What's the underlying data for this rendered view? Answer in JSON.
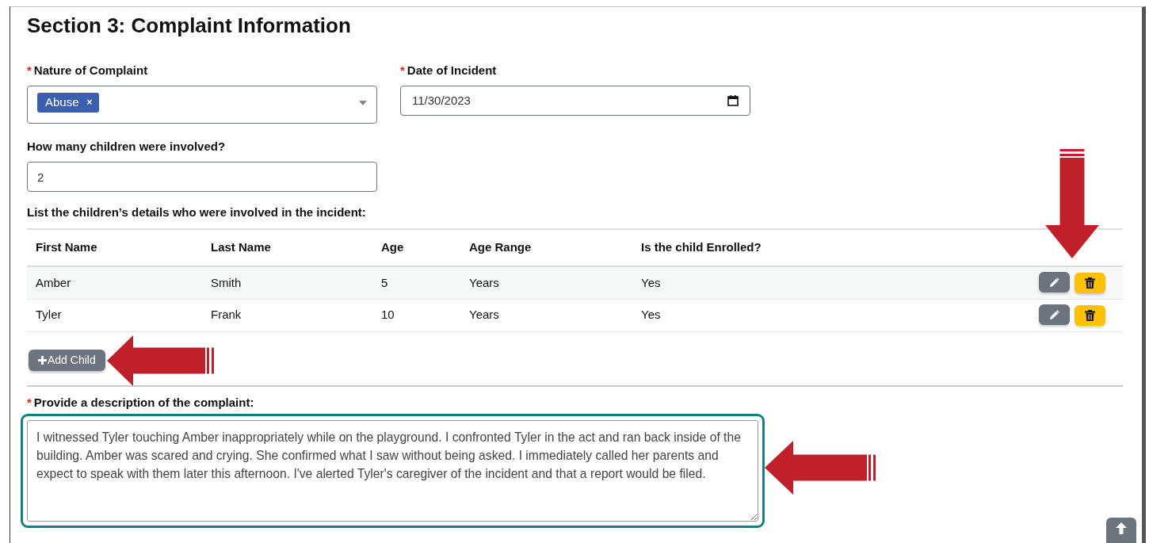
{
  "section_title": "Section 3: Complaint Information",
  "nature_of_complaint": {
    "label": "Nature of Complaint",
    "required_mark": "*",
    "tags": [
      {
        "text": "Abuse",
        "remove": "×"
      }
    ]
  },
  "date_of_incident": {
    "label": "Date of Incident",
    "required_mark": "*",
    "value": "11/30/2023"
  },
  "children_count": {
    "label": "How many children were involved?",
    "value": "2"
  },
  "children_table": {
    "caption": "List the children’s details who were involved in the incident:",
    "columns": [
      "First Name",
      "Last Name",
      "Age",
      "Age Range",
      "Is the child Enrolled?"
    ],
    "rows": [
      {
        "cells": [
          "Amber",
          "Smith",
          "5",
          "Years",
          "Yes"
        ]
      },
      {
        "cells": [
          "Tyler",
          "Frank",
          "10",
          "Years",
          "Yes"
        ]
      }
    ]
  },
  "add_child_button": "Add Child",
  "description": {
    "label": "Provide a description of the complaint:",
    "required_mark": "*",
    "focused": true,
    "value": "I witnessed Tyler touching Amber inappropriately while on the playground. I confronted Tyler in the act and ran back inside of the building. Amber was scared and crying. She confirmed what I saw without being asked. I immediately called her parents and expect to speak with them later this afternoon. I've alerted Tyler's caregiver of the incident and that a report would be filed."
  }
}
